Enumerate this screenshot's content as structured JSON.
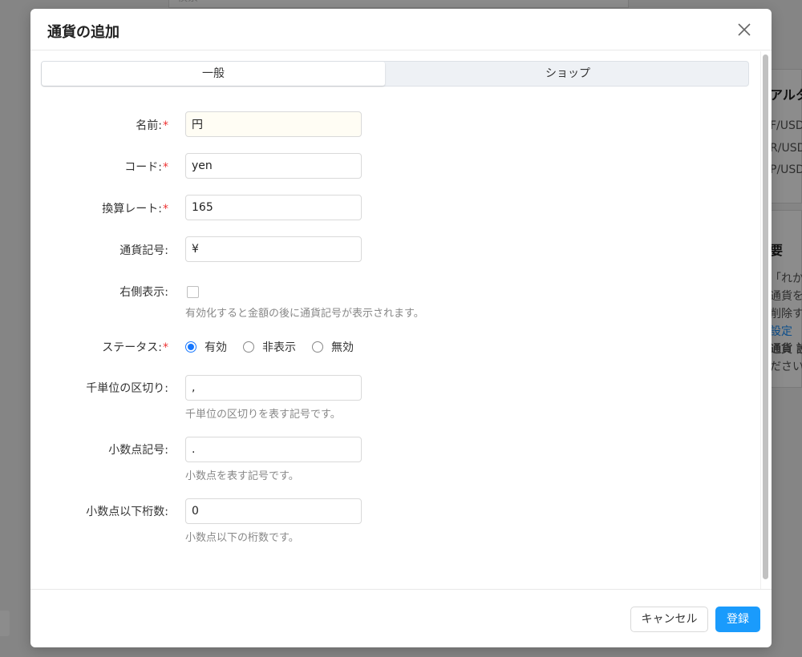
{
  "background": {
    "search_placeholder": "検索",
    "panel1_title": "アルタ",
    "panel1_lines": [
      "F/USD",
      "R/USD",
      "P/USD"
    ],
    "panel2_title": "要",
    "panel2_lines": [
      "「れか",
      "通貨を",
      "削除す",
      "設定",
      "通貨 設",
      "ださい。"
    ]
  },
  "modal": {
    "title": "通貨の追加",
    "tabs": [
      {
        "label": "一般",
        "active": true
      },
      {
        "label": "ショップ",
        "active": false
      }
    ],
    "fields": {
      "name": {
        "label": "名前:",
        "value": "円",
        "required": true
      },
      "code": {
        "label": "コード:",
        "value": "yen",
        "required": true
      },
      "rate": {
        "label": "換算レート:",
        "value": "165",
        "required": true
      },
      "symbol": {
        "label": "通貨記号:",
        "value": "¥",
        "required": false
      },
      "right_display": {
        "label": "右側表示:",
        "checked": false,
        "help": "有効化すると金額の後に通貨記号が表示されます。"
      },
      "status": {
        "label": "ステータス:",
        "required": true,
        "options": [
          "有効",
          "非表示",
          "無効"
        ],
        "selected": "有効"
      },
      "thousands": {
        "label": "千単位の区切り:",
        "value": ",",
        "help": "千単位の区切りを表す記号です。"
      },
      "decimal": {
        "label": "小数点記号:",
        "value": ".",
        "help": "小数点を表す記号です。"
      },
      "decimals": {
        "label": "小数点以下桁数:",
        "value": "0",
        "help": "小数点以下の桁数です。"
      }
    },
    "required_mark": "*",
    "footer": {
      "cancel_label": "キャンセル",
      "submit_label": "登録"
    }
  },
  "colors": {
    "primary": "#1a9bfc",
    "required": "#e33333",
    "radio_checked": "#1677ff"
  }
}
